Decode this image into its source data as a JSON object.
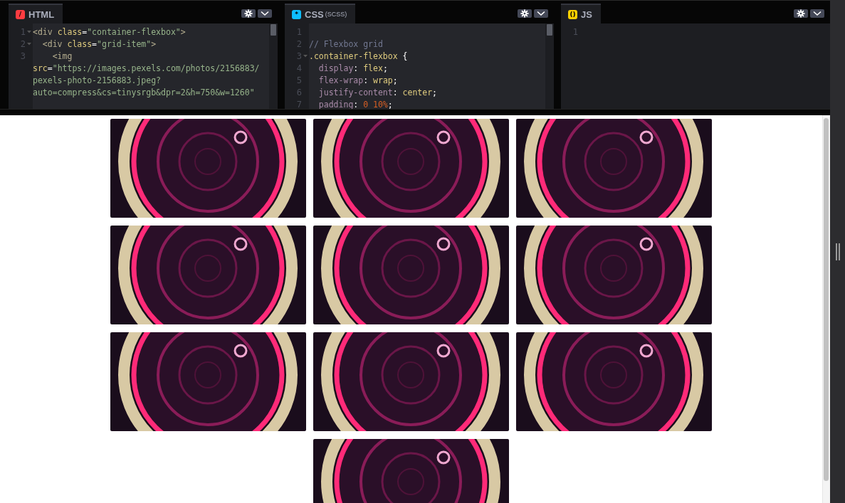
{
  "editors": [
    {
      "kind": "html",
      "icon_glyph": "/",
      "title": "HTML",
      "rows": [
        {
          "number": "1",
          "foldable": true,
          "segments": [
            {
              "kind": "tag",
              "text": "<div "
            },
            {
              "kind": "attr",
              "text": "class"
            },
            {
              "kind": "punct",
              "text": "="
            },
            {
              "kind": "string",
              "text": "\"container-flexbox\""
            },
            {
              "kind": "tag",
              "text": ">"
            }
          ]
        },
        {
          "number": "2",
          "foldable": true,
          "segments": [
            {
              "kind": "tag",
              "text": "  <div "
            },
            {
              "kind": "attr",
              "text": "class"
            },
            {
              "kind": "punct",
              "text": "="
            },
            {
              "kind": "string",
              "text": "\"grid-item\""
            },
            {
              "kind": "tag",
              "text": ">"
            }
          ]
        },
        {
          "number": "3",
          "foldable": false,
          "segments": [
            {
              "kind": "tag",
              "text": "    <img"
            }
          ]
        },
        {
          "segments": [
            {
              "kind": "attr",
              "text": "src"
            },
            {
              "kind": "punct",
              "text": "="
            },
            {
              "kind": "string",
              "text": "\"https://images.pexels.com/photos/2156883/"
            }
          ]
        },
        {
          "segments": [
            {
              "kind": "string",
              "text": "pexels-photo-2156883.jpeg?"
            }
          ]
        },
        {
          "segments": [
            {
              "kind": "string",
              "text": "auto=compress&cs=tinysrgb&dpr=2&h=750&w=1260\""
            }
          ]
        }
      ]
    },
    {
      "kind": "css",
      "icon_glyph": "*",
      "title": "CSS",
      "subtitle": "(SCSS)",
      "rows": [
        {
          "number": "1",
          "foldable": false,
          "segments": []
        },
        {
          "number": "2",
          "foldable": false,
          "segments": [
            {
              "kind": "comment",
              "text": "// Flexbox grid"
            }
          ]
        },
        {
          "number": "3",
          "foldable": true,
          "segments": [
            {
              "kind": "attr",
              "text": ".container-flexbox"
            },
            {
              "kind": "punct",
              "text": " {"
            }
          ]
        },
        {
          "number": "4",
          "foldable": false,
          "segments": [
            {
              "kind": "prop",
              "text": "  display"
            },
            {
              "kind": "punct",
              "text": ": "
            },
            {
              "kind": "attr",
              "text": "flex"
            },
            {
              "kind": "punct",
              "text": ";"
            }
          ]
        },
        {
          "number": "5",
          "foldable": false,
          "segments": [
            {
              "kind": "prop",
              "text": "  flex-wrap"
            },
            {
              "kind": "punct",
              "text": ": "
            },
            {
              "kind": "attr",
              "text": "wrap"
            },
            {
              "kind": "punct",
              "text": ";"
            }
          ]
        },
        {
          "number": "6",
          "foldable": false,
          "segments": [
            {
              "kind": "prop",
              "text": "  justify-content"
            },
            {
              "kind": "punct",
              "text": ": "
            },
            {
              "kind": "attr",
              "text": "center"
            },
            {
              "kind": "punct",
              "text": ";"
            }
          ]
        },
        {
          "number": "7",
          "foldable": false,
          "segments": [
            {
              "kind": "prop",
              "text": "  padding"
            },
            {
              "kind": "punct",
              "text": ": "
            },
            {
              "kind": "number",
              "text": "0 10%"
            },
            {
              "kind": "punct",
              "text": ";"
            }
          ]
        }
      ]
    },
    {
      "kind": "js",
      "icon_glyph": "()",
      "title": "JS",
      "rows": [
        {
          "number": "1",
          "foldable": false,
          "segments": []
        }
      ]
    }
  ],
  "preview": {
    "images": [
      {
        "kind": "photo"
      },
      {
        "kind": "photo"
      },
      {
        "kind": "photo"
      },
      {
        "kind": "photo"
      },
      {
        "kind": "photo"
      },
      {
        "kind": "photo"
      },
      {
        "kind": "photo"
      },
      {
        "kind": "photo"
      },
      {
        "kind": "photo"
      },
      {
        "kind": "photo"
      }
    ]
  }
}
